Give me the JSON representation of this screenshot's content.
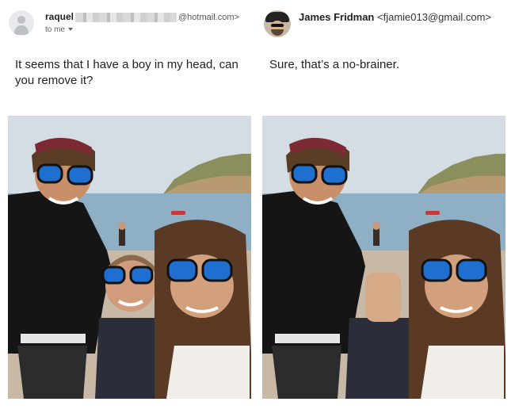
{
  "left_email": {
    "sender_name": "raquel",
    "sender_domain": "@hotmail.com>",
    "recipient": "to me",
    "message": "It seems that I have a boy in my head, can you remove it?"
  },
  "right_email": {
    "sender_name": "James Fridman",
    "sender_email": "<fjamie013@gmail.com>",
    "message": "Sure, that’s a no-brainer."
  },
  "icons": {
    "default_avatar": "person-icon",
    "recipient_dropdown": "chevron-down-icon"
  },
  "colors": {
    "sky": "#d4dde3",
    "sea": "#8fb0c4",
    "sand": "#c7b9a6",
    "lens": "#1e6fd0"
  }
}
